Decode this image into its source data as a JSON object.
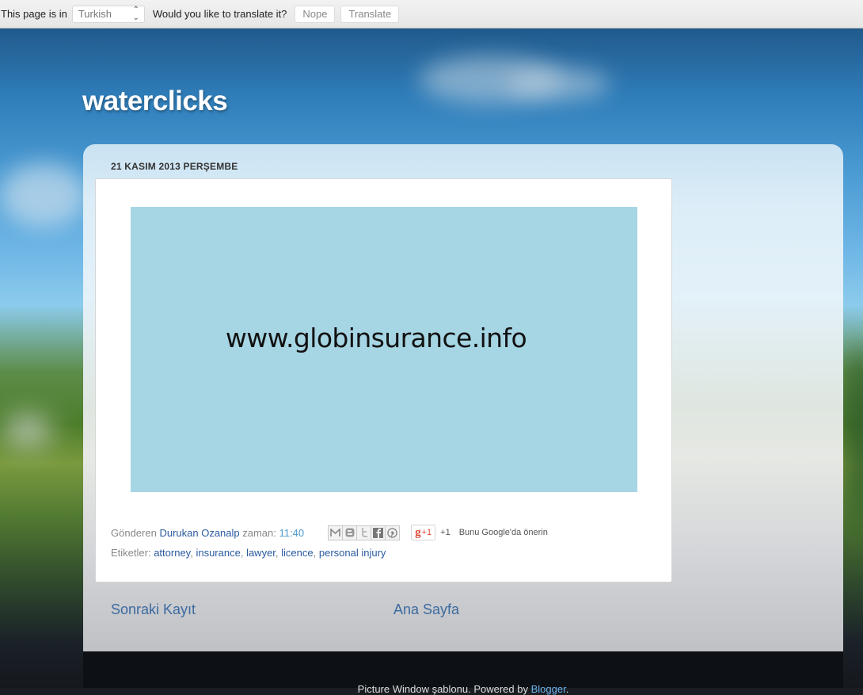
{
  "translate_bar": {
    "prefix": "This page is in",
    "language": "Turkish",
    "question": "Would you like to translate it?",
    "nope_label": "Nope",
    "translate_label": "Translate"
  },
  "blog": {
    "title": "waterclicks"
  },
  "post": {
    "date_header": "21 KASIM 2013 PERŞEMBE",
    "image_text": "www.globinsurance.info",
    "posted_by_label": "Gönderen",
    "author": "Durukan Ozanalp",
    "time_label": "zaman:",
    "time": "11:40",
    "share_icons": [
      "email-icon",
      "blogger-icon",
      "twitter-icon",
      "facebook-icon",
      "pinterest-icon"
    ],
    "gplus_label": "+1",
    "gplus_count": "+1",
    "recommend_text": "Bunu Google'da önerin",
    "labels_prefix": "Etiketler:",
    "labels": [
      "attorney",
      "insurance",
      "lawyer",
      "licence",
      "personal injury"
    ]
  },
  "nav": {
    "older": "Sonraki Kayıt",
    "home": "Ana Sayfa"
  },
  "footer": {
    "text": "Picture Window şablonu. Powered by ",
    "link": "Blogger",
    "suffix": "."
  },
  "colors": {
    "link": "#2a5aa0",
    "time_link": "#4a9ad0",
    "image_bg": "#a6d5e4",
    "gplus_red": "#dd4b39"
  }
}
